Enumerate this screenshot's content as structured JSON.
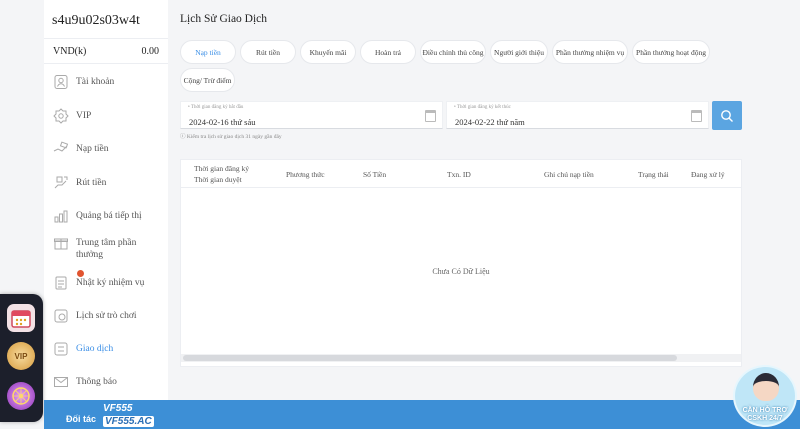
{
  "sidebar": {
    "username": "s4u9u02s03w4t",
    "currency": "VND(k)",
    "balance": "0.00",
    "items": [
      {
        "label": "Tài khoản",
        "icon": "user-badge-icon"
      },
      {
        "label": "VIP",
        "icon": "vip-shield-icon"
      },
      {
        "label": "Nạp tiền",
        "icon": "deposit-hand-icon"
      },
      {
        "label": "Rút tiền",
        "icon": "withdraw-icon"
      },
      {
        "label": "Quảng bá tiếp thị",
        "icon": "marketing-icon"
      },
      {
        "label": "Trung tâm phần thưởng",
        "icon": "gift-icon"
      },
      {
        "label": "Nhật ký nhiệm vụ",
        "icon": "task-log-icon"
      },
      {
        "label": "Lịch sử trò chơi",
        "icon": "game-history-icon"
      },
      {
        "label": "Giao dịch",
        "icon": "transaction-icon"
      },
      {
        "label": "Thông báo",
        "icon": "mail-icon"
      }
    ]
  },
  "dock": {
    "vip_label": "VIP"
  },
  "partner": {
    "label": "Đối tác",
    "logo_top": "VF555",
    "logo_bottom": "VF555.AC"
  },
  "support": {
    "line1": "CẦN HỖ TRỢ",
    "line2": "CSKH 24/7"
  },
  "main": {
    "title": "Lịch Sử Giao Dịch",
    "tabs": [
      {
        "label": "Nạp tiền",
        "active": true
      },
      {
        "label": "Rút tiền"
      },
      {
        "label": "Khuyến mãi"
      },
      {
        "label": "Hoàn trả"
      },
      {
        "label": "Điều chỉnh thủ công"
      },
      {
        "label": "Người giới thiệu"
      },
      {
        "label": "Phần thưởng nhiệm vụ"
      },
      {
        "label": "Phần thưởng hoạt động"
      },
      {
        "label": "Cộng/ Trừ điểm"
      }
    ],
    "start_date": {
      "placeholder": "Thời gian đăng ký bắt đầu",
      "value": "2024-02-16 thứ sáu"
    },
    "end_date": {
      "placeholder": "Thời gian đăng ký kết thúc",
      "value": "2024-02-22 thứ năm"
    },
    "hint": "Kiểm tra lịch sử giao dịch 31 ngày gần đây",
    "table": {
      "headers": [
        "Thời gian đăng ký",
        "Thời gian duyệt",
        "Phương thức",
        "Số Tiền",
        "Txn. ID",
        "Ghi chú nạp tiền",
        "Trạng thái",
        "Đang xử lý"
      ],
      "empty_text": "Chưa Có Dữ Liệu"
    }
  },
  "colors": {
    "accent": "#3a8ee6",
    "search_button": "#5ba5e1",
    "partner_bar": "#3d8fd6",
    "badge": "#e1542f"
  }
}
